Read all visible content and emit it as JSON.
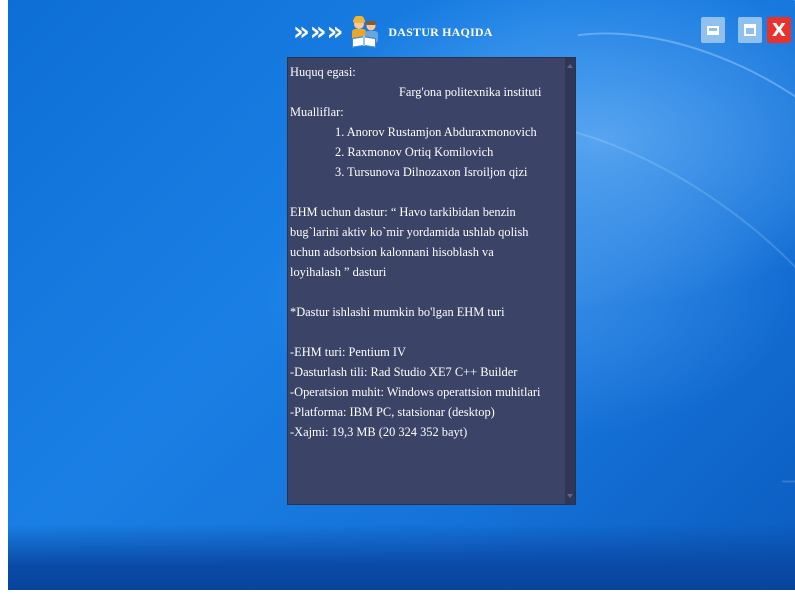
{
  "window": {
    "title": "DASTUR HAQIDA",
    "chevrons": [
      "»",
      "»",
      "»"
    ],
    "icon": "students-reading-icon",
    "controls": {
      "minimize_icon": "minimize-icon",
      "maximize_icon": "maximize-icon",
      "close_label": "X"
    }
  },
  "content": {
    "lines": [
      {
        "text": "Huquq egasi:",
        "indent": 0
      },
      {
        "text": "Farg'ona politexnika instituti",
        "indent": 1
      },
      {
        "text": "Mualliflar:",
        "indent": 0
      },
      {
        "text": "1. Anorov Rustamjon Abduraxmonovich",
        "indent": 2
      },
      {
        "text": "2. Raxmonov Ortiq Komilovich",
        "indent": 2
      },
      {
        "text": "3. Tursunova Dilnozaxon Isroiljon qizi",
        "indent": 2
      },
      {
        "text": "",
        "indent": 0
      },
      {
        "text": "EHM uchun dastur: “ Havo tarkibidan benzin",
        "indent": 0
      },
      {
        "text": "bug`larini aktiv ko`mir yordamida ushlab qolish",
        "indent": 0
      },
      {
        "text": "uchun adsorbsion kalonnani hisoblash va",
        "indent": 0
      },
      {
        "text": "loyihalash ” dasturi",
        "indent": 0
      },
      {
        "text": "",
        "indent": 0
      },
      {
        "text": "*Dastur ishlashi mumkin bo'lgan EHM turi",
        "indent": 0
      },
      {
        "text": "",
        "indent": 0
      },
      {
        "text": "-EHM turi: Pentium IV",
        "indent": 0
      },
      {
        "text": "-Dasturlash tili: Rad Studio XE7 C++ Builder",
        "indent": 0
      },
      {
        "text": "-Operatsion muhit: Windows operattsion muhitlari",
        "indent": 0
      },
      {
        "text": "-Platforma: IBM PC, statsionar (desktop)",
        "indent": 0
      },
      {
        "text": "-Xajmi: 19,3 MB (20 324 352 bayt)",
        "indent": 0
      }
    ]
  },
  "colors": {
    "desktop": "#1a7fe4",
    "memo_background": "#3b4466",
    "close_button": "#e8322d",
    "window_button": "#8fc0ee"
  }
}
